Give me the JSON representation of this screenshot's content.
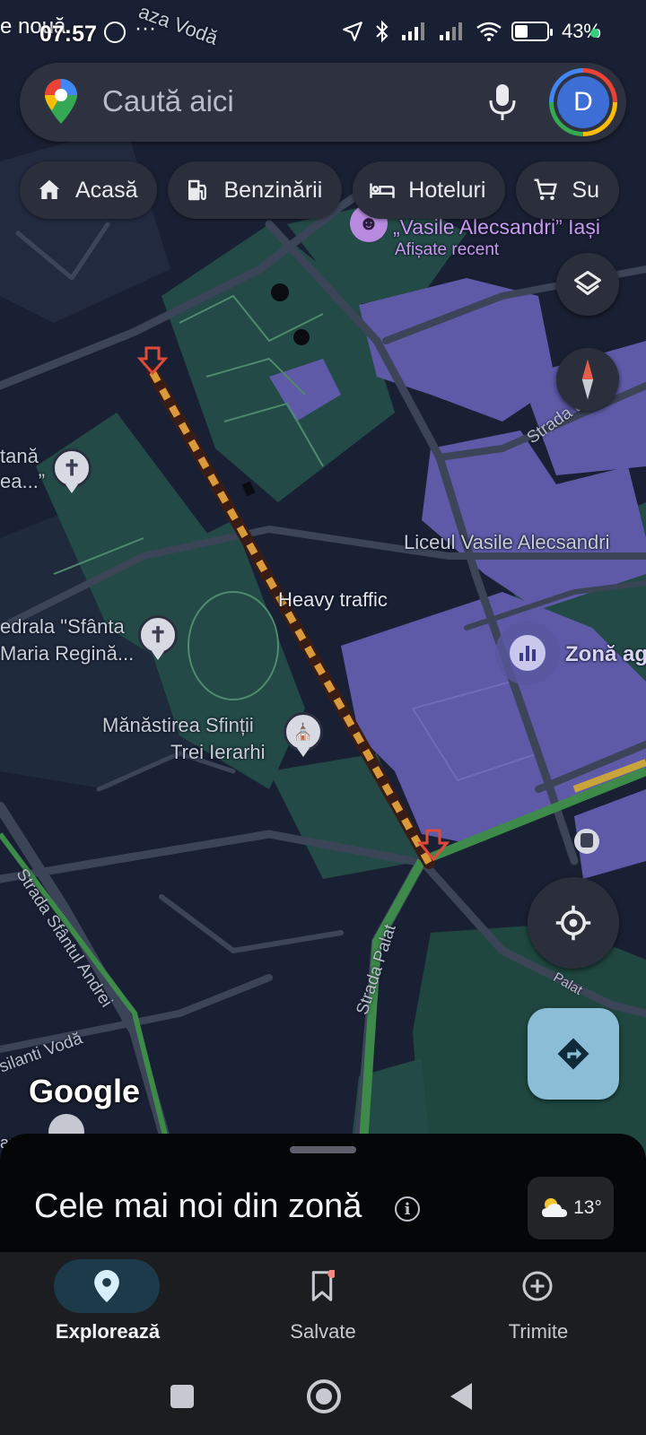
{
  "status_bar": {
    "carrier_fragment": "e nouă",
    "time": "07:57",
    "battery": "43%",
    "icons": [
      "whatsapp-icon",
      "more-icon",
      "location-icon",
      "bluetooth-icon",
      "signal-icon",
      "signal-icon",
      "wifi-icon",
      "battery-icon"
    ]
  },
  "search": {
    "placeholder": "Caută aici",
    "avatar_letter": "D"
  },
  "chips": [
    {
      "label": "Acasă",
      "icon": "home-icon"
    },
    {
      "label": "Benzinării",
      "icon": "gas-station-icon"
    },
    {
      "label": "Hoteluri",
      "icon": "hotel-icon"
    },
    {
      "label": "Su",
      "icon": "cart-icon"
    }
  ],
  "map": {
    "top_road_label": "aza Vodă",
    "poi_recent_name": "„Vasile Alecsandri” Iași",
    "poi_recent_sub": "Afișate recent",
    "poi_recent_fragment": "l",
    "church1_label_a": "tană",
    "church1_label_b": "ea...”",
    "heavy_traffic": "Heavy traffic",
    "school_label": "Liceul Vasile Alecsandri",
    "cathedral_label_a": "edrala \"Sfânta",
    "cathedral_label_b": "Maria Regină...",
    "monastery_label_a": "Mănăstirea Sfinții",
    "monastery_label_b": "Trei Ierarhi",
    "zone_label": "Zonă ag",
    "road_sfantul_andrei": "Strada Sfântul Andrei",
    "road_palat": "Strada Palat",
    "road_ipsilanti": "silanti Vodă",
    "road_right_top": "Strada ul S",
    "road_palat_right": "Palat",
    "bottom_left_fragment": "apu",
    "google": "Google"
  },
  "sheet": {
    "title": "Cele mai noi din zonă",
    "temperature": "13°"
  },
  "bottom_nav": [
    {
      "label": "Explorează",
      "icon": "location-pin-icon",
      "active": true
    },
    {
      "label": "Salvate",
      "icon": "bookmark-icon",
      "active": false
    },
    {
      "label": "Trimite",
      "icon": "add-circle-icon",
      "active": false
    }
  ],
  "colors": {
    "map_background": "#1a2033",
    "park": "#234a46",
    "building_purple": "#5e5aa8",
    "traffic_heavy": "#d98c3a",
    "accent_blue": "#8bbdd6"
  }
}
